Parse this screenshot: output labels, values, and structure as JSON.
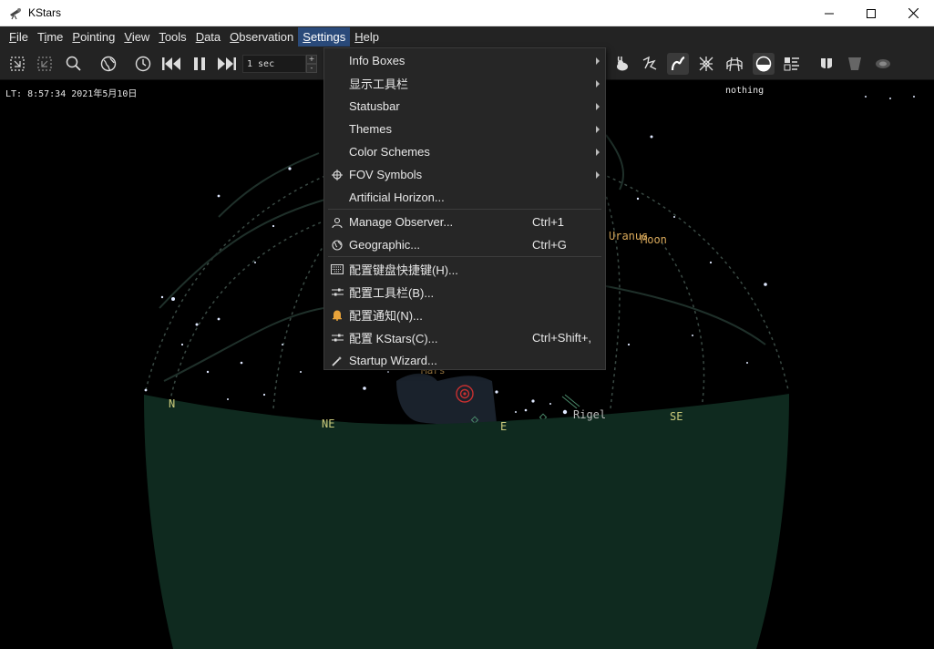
{
  "window": {
    "title": "KStars"
  },
  "menubar": {
    "items": [
      {
        "label": "File",
        "mnemonic": "F"
      },
      {
        "label": "Time",
        "mnemonic": "i"
      },
      {
        "label": "Pointing",
        "mnemonic": "P"
      },
      {
        "label": "View",
        "mnemonic": "V"
      },
      {
        "label": "Tools",
        "mnemonic": "T"
      },
      {
        "label": "Data",
        "mnemonic": "D"
      },
      {
        "label": "Observation",
        "mnemonic": "O"
      },
      {
        "label": "Settings",
        "mnemonic": "S"
      },
      {
        "label": "Help",
        "mnemonic": "H"
      }
    ],
    "active": "Settings"
  },
  "toolbar": {
    "time_step": "1 sec",
    "spin_up": "+",
    "spin_down": "-"
  },
  "infoboxes": {
    "time": "LT: 8:57:34   2021年5月10日",
    "focus": "nothing"
  },
  "sky": {
    "horizon_color": "#0f2a1f",
    "labels": {
      "north": "N",
      "north_east": "NE",
      "east": "E",
      "south_east": "SE",
      "rigel": "Rigel",
      "uranus": "Uranus",
      "moon": "Moon",
      "mars": "Mars"
    }
  },
  "settings_menu": {
    "items": [
      {
        "label": "Info Boxes",
        "submenu": true
      },
      {
        "label": "显示工具栏",
        "submenu": true
      },
      {
        "label": "Statusbar",
        "submenu": true
      },
      {
        "label": "Themes",
        "submenu": true
      },
      {
        "label": "Color Schemes",
        "submenu": true
      },
      {
        "label": "FOV Symbols",
        "submenu": true,
        "icon": "crosshair-icon"
      },
      {
        "label": "Artificial Horizon..."
      },
      {
        "label": "Manage Observer...",
        "shortcut": "Ctrl+1",
        "icon": "user-icon"
      },
      {
        "label": "Geographic...",
        "shortcut": "Ctrl+G",
        "icon": "globe-icon"
      },
      {
        "label": "配置键盘快捷键(H)...",
        "icon": "keyboard-icon"
      },
      {
        "label": "配置工具栏(B)...",
        "icon": "sliders-icon"
      },
      {
        "label": "配置通知(N)...",
        "icon": "bell-icon"
      },
      {
        "label": "配置 KStars(C)...",
        "shortcut": "Ctrl+Shift+,",
        "icon": "sliders-icon"
      },
      {
        "label": "Startup Wizard...",
        "icon": "wand-icon"
      }
    ]
  },
  "colors": {
    "menubar_bg": "#232323",
    "menu_active": "#2a4a7a",
    "dropdown_bg": "#262626",
    "compass_label": "#c9c97a",
    "planet_label": "#d8a85a"
  }
}
